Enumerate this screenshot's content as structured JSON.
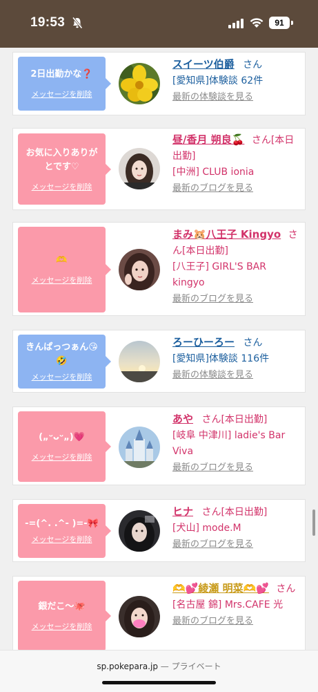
{
  "status": {
    "time": "19:53",
    "battery": "91"
  },
  "cards": [
    {
      "bubble_color": "blue",
      "message": "2日出勤かな❓",
      "delete_label": "メッセージを削除",
      "name": "スイーツ伯爵",
      "suffix": "さん",
      "detail": "[愛知県]体験談 62件",
      "more": "最新の体験談を見る",
      "avatar": "yellow-flower"
    },
    {
      "bubble_color": "pink",
      "message": "お気に入りありがとです♡",
      "delete_label": "メッセージを削除",
      "name": "昼/香月 朔良🍒",
      "suffix": "さん[本日出勤]",
      "detail": "[中洲] CLUB ionia",
      "more": "最新のブログを見る",
      "avatar": "woman-portrait"
    },
    {
      "bubble_color": "pink",
      "message": "🫶",
      "delete_label": "メッセージを削除",
      "name": "まみ🐹八王子 Kingyo",
      "suffix": "さん[本日出勤]",
      "detail": "[八王子] GIRL'S BAR kingyo",
      "more": "最新のブログを見る",
      "avatar": "woman-portrait"
    },
    {
      "bubble_color": "blue",
      "message": "きんぱっつぁん😘🤣",
      "delete_label": "メッセージを削除",
      "name": "ろーひーろー",
      "suffix": "さん",
      "detail": "[愛知県]体験談 116件",
      "more": "最新の体験談を見る",
      "avatar": "sunset-sky"
    },
    {
      "bubble_color": "pink",
      "message": "(„ᵕᴗᵕ„)💗",
      "delete_label": "メッセージを削除",
      "name": "あや",
      "suffix": "さん[本日出勤]",
      "detail": "[岐阜 中津川] ladie's Bar Viva",
      "more": "最新のブログを見る",
      "avatar": "castle"
    },
    {
      "bubble_color": "pink",
      "message": "-=(^.  .^-  )=-🎀",
      "delete_label": "メッセージを削除",
      "name": "ヒナ",
      "suffix": "さん[本日出勤]",
      "detail": "[犬山] mode.M",
      "more": "最新のブログを見る",
      "avatar": "woman-portrait"
    },
    {
      "bubble_color": "pink",
      "message": "銀だこ〜🐙",
      "delete_label": "メッセージを削除",
      "name": "🫶💕綾瀬 明菜🫶💕",
      "suffix": "さん",
      "detail": "[名古屋 錦] Mrs.CAFE 光",
      "more": "最新のブログを見る",
      "avatar": "woman-portrait-blurred"
    }
  ],
  "bottom_bar": {
    "url": "sp.pokepara.jp",
    "private": "— プライベート"
  }
}
